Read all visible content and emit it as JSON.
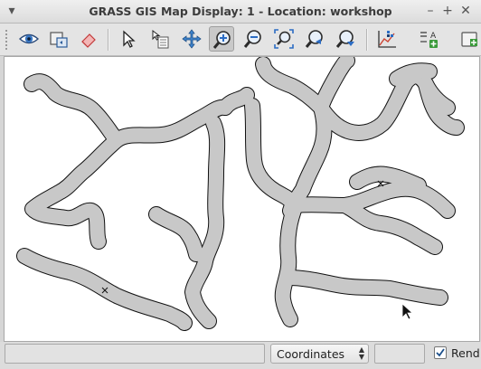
{
  "window": {
    "title": "GRASS GIS Map Display: 1  - Location: workshop",
    "menu_glyph": "▾",
    "minimize_glyph": "–",
    "maximize_glyph": "+",
    "close_glyph": "✕"
  },
  "toolbar": {
    "tools": [
      {
        "name": "display-map-icon",
        "active": false
      },
      {
        "name": "render-map-icon",
        "active": false
      },
      {
        "name": "erase-display-icon",
        "active": false
      },
      {
        "name": "pointer-icon",
        "active": false
      },
      {
        "name": "query-icon",
        "active": false
      },
      {
        "name": "pan-icon",
        "active": false
      },
      {
        "name": "zoom-in-icon",
        "active": true
      },
      {
        "name": "zoom-out-icon",
        "active": false
      },
      {
        "name": "zoom-extent-icon",
        "active": false
      },
      {
        "name": "zoom-back-icon",
        "active": false
      },
      {
        "name": "zoom-menu-icon",
        "active": false
      },
      {
        "name": "analyze-icon",
        "active": false
      },
      {
        "name": "map-elements-icon",
        "active": false
      },
      {
        "name": "save-icon",
        "active": false
      }
    ]
  },
  "statusbar": {
    "mode_label": "Coordinates",
    "render_label": "Rend",
    "render_checked": true
  },
  "map": {
    "stream_color": "#c8c8c8",
    "outline_color": "#111111"
  }
}
